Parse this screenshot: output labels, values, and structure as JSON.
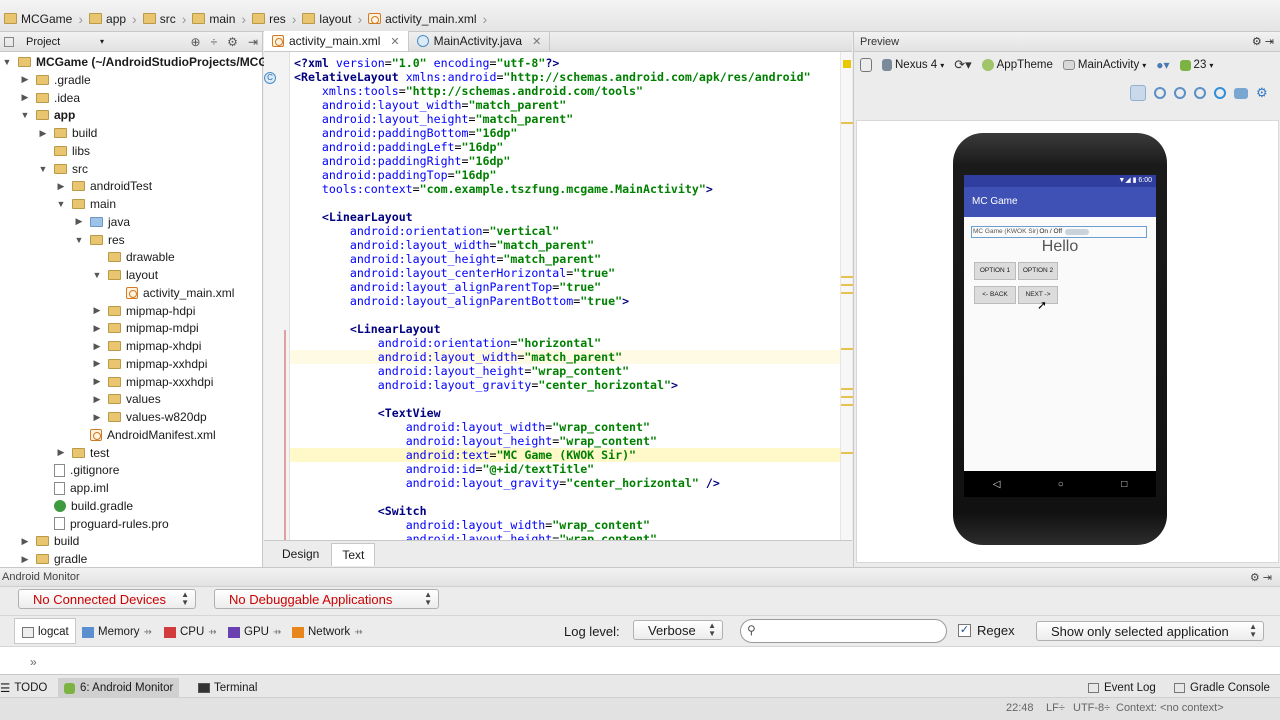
{
  "breadcrumb": [
    "MCGame",
    "app",
    "src",
    "main",
    "res",
    "layout",
    "activity_main.xml"
  ],
  "project_panel": {
    "header": "Project",
    "tree": [
      {
        "label": "MCGame (~/AndroidStudioProjects/MCGam",
        "kind": "folder",
        "expanded": true
      },
      {
        "label": ".gradle",
        "kind": "folder",
        "expanded": false
      },
      {
        "label": ".idea",
        "kind": "folder",
        "expanded": false
      },
      {
        "label": "app",
        "kind": "folder",
        "expanded": true
      },
      {
        "label": "build",
        "kind": "folder",
        "expanded": false
      },
      {
        "label": "libs",
        "kind": "folder",
        "expanded": null
      },
      {
        "label": "src",
        "kind": "folder",
        "expanded": true
      },
      {
        "label": "androidTest",
        "kind": "folder",
        "expanded": false
      },
      {
        "label": "main",
        "kind": "folder",
        "expanded": true
      },
      {
        "label": "java",
        "kind": "folder-blue",
        "expanded": false
      },
      {
        "label": "res",
        "kind": "folder",
        "expanded": true
      },
      {
        "label": "drawable",
        "kind": "folder",
        "expanded": null
      },
      {
        "label": "layout",
        "kind": "folder",
        "expanded": true
      },
      {
        "label": "activity_main.xml",
        "kind": "xml",
        "expanded": null
      },
      {
        "label": "mipmap-hdpi",
        "kind": "folder",
        "expanded": false
      },
      {
        "label": "mipmap-mdpi",
        "kind": "folder",
        "expanded": false
      },
      {
        "label": "mipmap-xhdpi",
        "kind": "folder",
        "expanded": false
      },
      {
        "label": "mipmap-xxhdpi",
        "kind": "folder",
        "expanded": false
      },
      {
        "label": "mipmap-xxxhdpi",
        "kind": "folder",
        "expanded": false
      },
      {
        "label": "values",
        "kind": "folder",
        "expanded": false
      },
      {
        "label": "values-w820dp",
        "kind": "folder",
        "expanded": false
      },
      {
        "label": "AndroidManifest.xml",
        "kind": "xml",
        "expanded": null
      },
      {
        "label": "test",
        "kind": "folder",
        "expanded": false
      },
      {
        "label": ".gitignore",
        "kind": "file",
        "expanded": null
      },
      {
        "label": "app.iml",
        "kind": "file",
        "expanded": null
      },
      {
        "label": "build.gradle",
        "kind": "gradle",
        "expanded": null
      },
      {
        "label": "proguard-rules.pro",
        "kind": "file",
        "expanded": null
      },
      {
        "label": "build",
        "kind": "folder",
        "expanded": false
      },
      {
        "label": "gradle",
        "kind": "folder",
        "expanded": false
      }
    ]
  },
  "editor": {
    "tabs": [
      {
        "label": "activity_main.xml",
        "active": true
      },
      {
        "label": "MainActivity.java",
        "active": false
      }
    ],
    "code_lines": [
      "<?xml version=\"1.0\" encoding=\"utf-8\"?>",
      "<RelativeLayout xmlns:android=\"http://schemas.android.com/apk/res/android\"",
      "    xmlns:tools=\"http://schemas.android.com/tools\"",
      "    android:layout_width=\"match_parent\"",
      "    android:layout_height=\"match_parent\"",
      "    android:paddingBottom=\"16dp\"",
      "    android:paddingLeft=\"16dp\"",
      "    android:paddingRight=\"16dp\"",
      "    android:paddingTop=\"16dp\"",
      "    tools:context=\"com.example.tszfung.mcgame.MainActivity\">",
      "",
      "    <LinearLayout",
      "        android:orientation=\"vertical\"",
      "        android:layout_width=\"match_parent\"",
      "        android:layout_height=\"match_parent\"",
      "        android:layout_centerHorizontal=\"true\"",
      "        android:layout_alignParentTop=\"true\"",
      "        android:layout_alignParentBottom=\"true\">",
      "",
      "        <LinearLayout",
      "            android:orientation=\"horizontal\"",
      "            android:layout_width=\"match_parent\"",
      "            android:layout_height=\"wrap_content\"",
      "            android:layout_gravity=\"center_horizontal\">",
      "",
      "            <TextView",
      "                android:layout_width=\"wrap_content\"",
      "                android:layout_height=\"wrap_content\"",
      "                android:text=\"MC Game (KWOK Sir)\"",
      "                android:id=\"@+id/textTitle\"",
      "                android:layout_gravity=\"center_horizontal\" />",
      "",
      "            <Switch",
      "                android:layout_width=\"wrap_content\"",
      "                android:layout_height=\"wrap_content\""
    ],
    "bottom_tabs": [
      {
        "label": "Design",
        "active": false
      },
      {
        "label": "Text",
        "active": true
      }
    ]
  },
  "preview": {
    "header": "Preview",
    "device": "Nexus 4",
    "theme": "AppTheme",
    "activity": "MainActivity",
    "api": "23",
    "phone": {
      "time": "6:00",
      "app_title": "MC Game",
      "title_text": "MC Game (KWOK Sir)",
      "switch_text": "On / Off",
      "hello": "Hello",
      "option1": "OPTION 1",
      "option2": "OPTION 2",
      "back": "<- BACK",
      "next": "NEXT ->"
    }
  },
  "monitor": {
    "title": "Android Monitor",
    "devices": "No Connected Devices",
    "apps": "No Debuggable Applications",
    "tabs": [
      "logcat",
      "Memory",
      "CPU",
      "GPU",
      "Network"
    ],
    "log_level_label": "Log level:",
    "log_level": "Verbose",
    "search_placeholder": "",
    "regex_label": "Regex",
    "filter": "Show only selected application",
    "more": "»"
  },
  "statusbar": {
    "todo": "TODO",
    "android_monitor": "6: Android Monitor",
    "terminal": "Terminal",
    "event_log": "Event Log",
    "gradle_console": "Gradle Console",
    "position": "22:48",
    "line_sep": "LF÷",
    "encoding": "UTF-8÷",
    "context": "Context: <no context>"
  },
  "colors": {
    "tag": "#000080",
    "attr": "#0000ff",
    "string": "#008000",
    "app_bar": "#3f51b5",
    "error_text": "#cc0000"
  }
}
